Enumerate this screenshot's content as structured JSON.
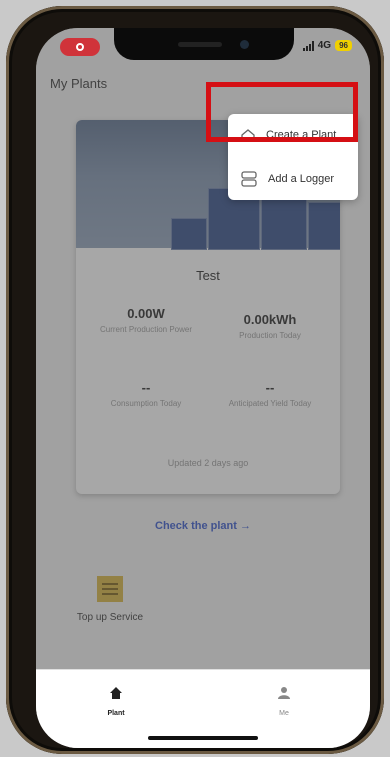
{
  "status_bar": {
    "network": "4G",
    "battery": "96"
  },
  "header": {
    "title": "My Plants"
  },
  "menu": {
    "items": [
      {
        "label": "Create a Plant",
        "icon": "plant-icon"
      },
      {
        "label": "Add a Logger",
        "icon": "logger-icon"
      }
    ]
  },
  "plant_card": {
    "name": "Test",
    "metrics": [
      {
        "value": "0.00W",
        "label": "Current Production Power"
      },
      {
        "value": "0.00kWh",
        "label": "Production Today"
      },
      {
        "value": "--",
        "label": "Consumption Today"
      },
      {
        "value": "--",
        "label": "Anticipated Yield Today"
      }
    ],
    "updated": "Updated 2 days ago"
  },
  "check_link": "Check the plant →",
  "service": {
    "label": "Top up Service",
    "icon": "service-icon"
  },
  "tabbar": {
    "tabs": [
      {
        "label": "Plant",
        "icon": "home-icon",
        "active": true
      },
      {
        "label": "Me",
        "icon": "person-icon",
        "active": false
      }
    ]
  },
  "colors": {
    "highlight": "#d50f14",
    "link": "#3355cc",
    "record": "#d0333a"
  }
}
